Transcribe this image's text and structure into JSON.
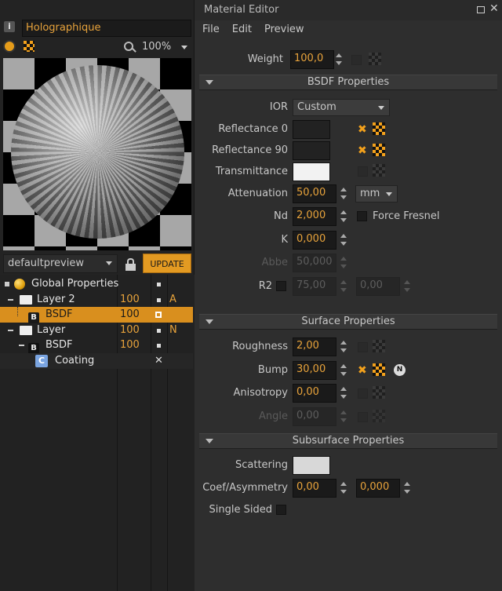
{
  "window": {
    "title": "Material Editor"
  },
  "menu": [
    "File",
    "Edit",
    "Preview"
  ],
  "left": {
    "material_name": "Holographique",
    "zoom": "100%",
    "preview_scene": "defaultpreview",
    "update_label": "UPDATE",
    "tree": [
      {
        "label": "Global Properties",
        "value": "",
        "flag": ""
      },
      {
        "label": "Layer 2",
        "value": "100",
        "flag": "A"
      },
      {
        "label": "BSDF",
        "value": "100",
        "flag": "",
        "selected": true
      },
      {
        "label": "Layer",
        "value": "100",
        "flag": "N"
      },
      {
        "label": "BSDF",
        "value": "100",
        "flag": ""
      },
      {
        "label": "Coating",
        "value": "",
        "flag": "✕"
      }
    ]
  },
  "weight": {
    "label": "Weight",
    "value": "100,0"
  },
  "sections": {
    "bsdf": "BSDF Properties",
    "surface": "Surface Properties",
    "subsurface": "Subsurface Properties"
  },
  "bsdf": {
    "ior": {
      "label": "IOR",
      "value": "Custom"
    },
    "reflectance0": {
      "label": "Reflectance 0"
    },
    "reflectance90": {
      "label": "Reflectance 90"
    },
    "transmittance": {
      "label": "Transmittance"
    },
    "attenuation": {
      "label": "Attenuation",
      "value": "50,00",
      "unit": "mm"
    },
    "nd": {
      "label": "Nd",
      "value": "2,000",
      "fresnel": "Force Fresnel"
    },
    "k": {
      "label": "K",
      "value": "0,000"
    },
    "abbe": {
      "label": "Abbe",
      "value": "50,000"
    },
    "r2": {
      "label": "R2",
      "value1": "75,00",
      "value2": "0,00"
    }
  },
  "surface": {
    "roughness": {
      "label": "Roughness",
      "value": "2,00"
    },
    "bump": {
      "label": "Bump",
      "value": "30,00",
      "badge": "N"
    },
    "anisotropy": {
      "label": "Anisotropy",
      "value": "0,00"
    },
    "angle": {
      "label": "Angle",
      "value": "0,00"
    }
  },
  "subsurface": {
    "scattering": {
      "label": "Scattering"
    },
    "coef": {
      "label": "Coef/Asymmetry",
      "value1": "0,00",
      "value2": "0,000"
    },
    "single_sided": {
      "label": "Single Sided"
    }
  },
  "colors": {
    "accent": "#f3a11c",
    "value_text": "#e8a33b",
    "selection": "#d98f1e"
  }
}
